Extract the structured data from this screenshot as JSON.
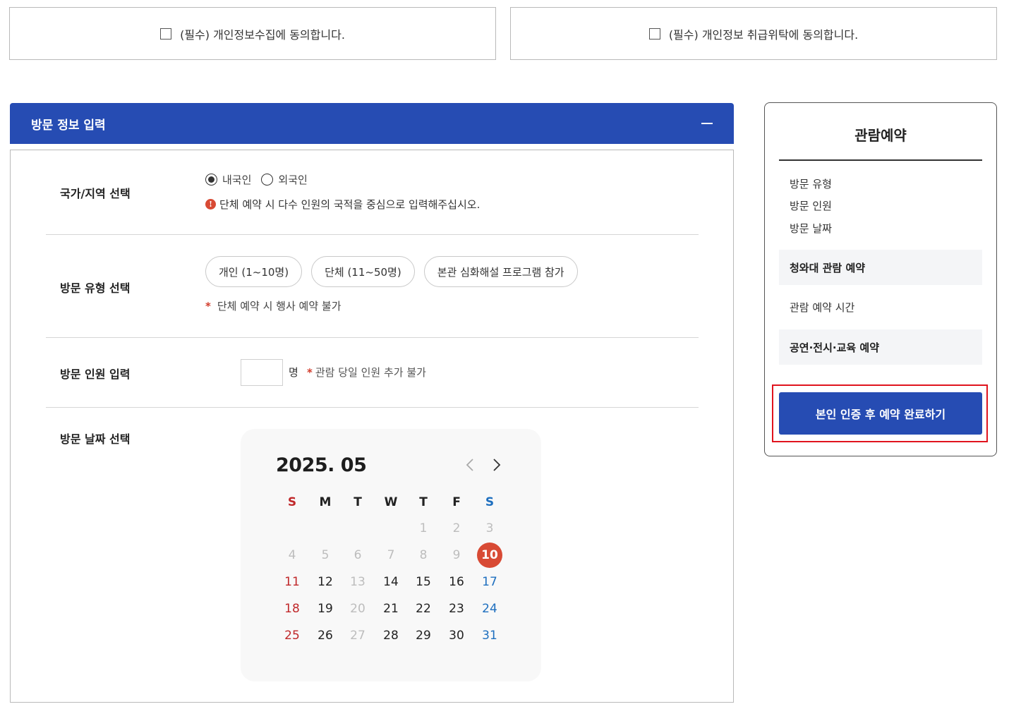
{
  "agreements": [
    {
      "label": "(필수) 개인정보수집에 동의합니다."
    },
    {
      "label": "(필수) 개인정보 취급위탁에 동의합니다."
    }
  ],
  "section": {
    "title": "방문 정보 입력",
    "toggle_icon": "minus-icon"
  },
  "country": {
    "label": "국가/지역 선택",
    "options": [
      "내국인",
      "외국인"
    ],
    "selected": "내국인",
    "note": "단체 예약 시 다수 인원의 국적을 중심으로 입력해주십시오."
  },
  "visit_type": {
    "label": "방문 유형 선택",
    "options": [
      "개인 (1~10명)",
      "단체 (11~50명)",
      "본관 심화해설 프로그램 참가"
    ],
    "note_star": "*",
    "note": "단체 예약 시 행사 예약 불가"
  },
  "headcount": {
    "label": "방문 인원 입력",
    "value": "",
    "unit": "명",
    "note_star": "*",
    "note": "관람 당일 인원 추가 불가"
  },
  "date": {
    "label": "방문 날짜 선택"
  },
  "calendar": {
    "title": "2025. 05",
    "weekdays": [
      "S",
      "M",
      "T",
      "W",
      "T",
      "F",
      "S"
    ],
    "first_weekday_index": 4,
    "days_in_month": 31,
    "today": 10,
    "disabled_days": [
      1,
      2,
      3,
      4,
      5,
      6,
      7,
      8,
      9,
      13,
      20,
      27
    ],
    "colors": {
      "sunday": "#c0282a",
      "saturday": "#1e6fbf",
      "today_bg": "#d84a34",
      "disabled": "#bdbdbd"
    }
  },
  "summary": {
    "title": "관람예약",
    "items": [
      "방문 유형",
      "방문 인원",
      "방문 날짜"
    ],
    "block1": "청와대 관람 예약",
    "plain": "관람 예약 시간",
    "block2": "공연·전시·교육 예약",
    "submit_label": "본인 인증 후 예약 완료하기"
  },
  "colors": {
    "primary": "#264cb3",
    "highlight_border": "#e0141e"
  }
}
